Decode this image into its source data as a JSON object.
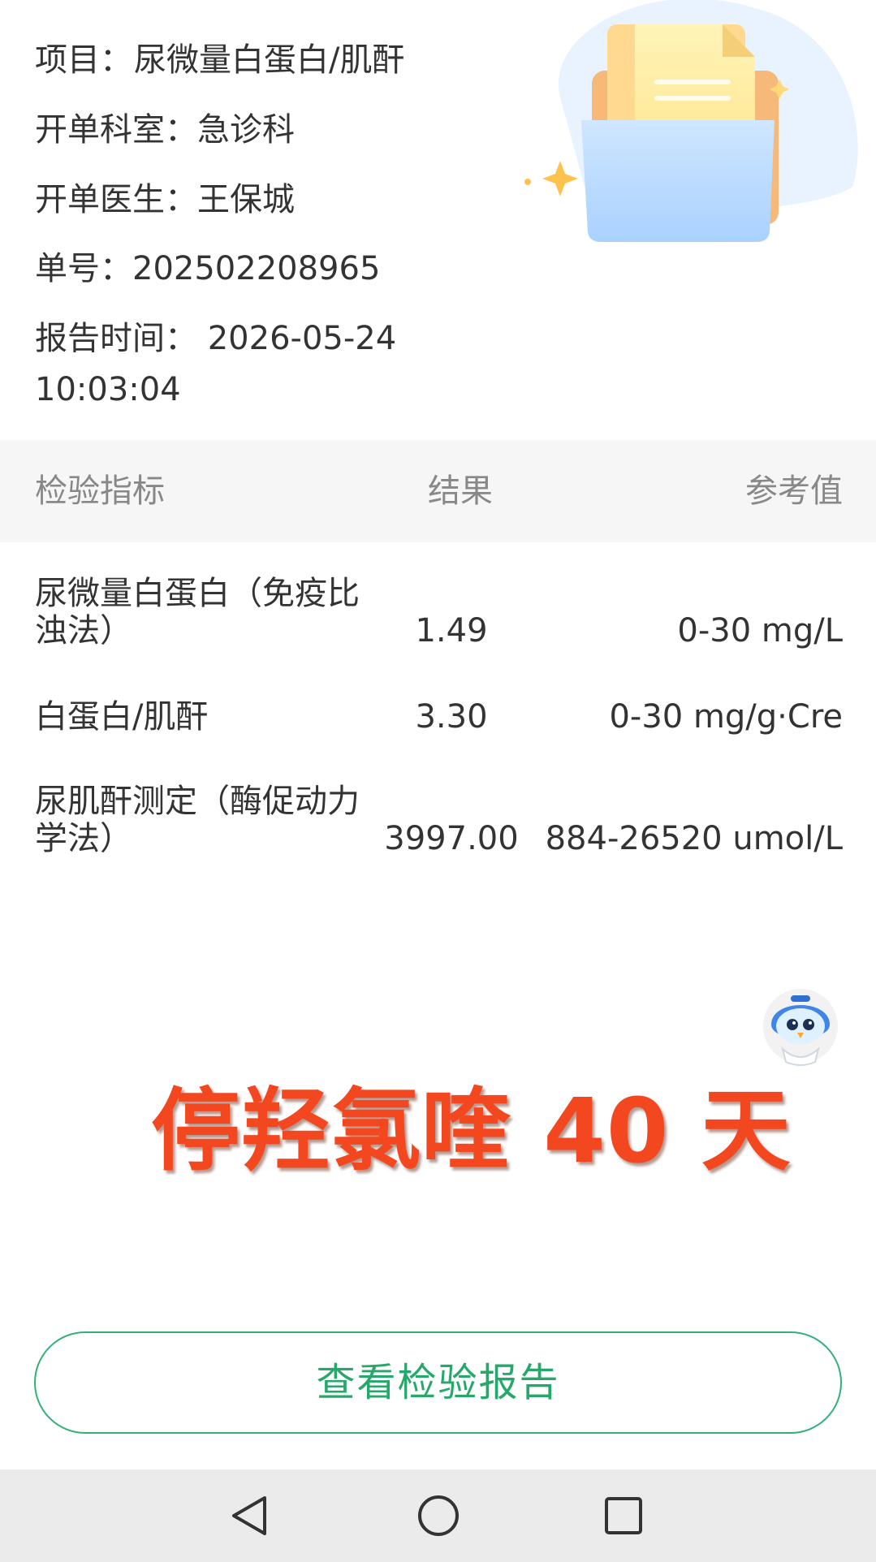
{
  "info": {
    "project_label": "项目：",
    "project_value": "尿微量白蛋白/肌酐",
    "dept_label": "开单科室：",
    "dept_value": "急诊科",
    "doctor_label": "开单医生：",
    "doctor_value": "王保城",
    "order_label": "单号：",
    "order_value": "202502208965",
    "time_label": "报告时间：",
    "time_date": "2026-05-24",
    "time_clock": "10:03:04"
  },
  "table": {
    "headers": {
      "name": "检验指标",
      "result": "结果",
      "reference": "参考值"
    },
    "rows": [
      {
        "name": "尿微量白蛋白（免疫比浊法）",
        "result": "1.49",
        "reference": "0-30 mg/L"
      },
      {
        "name": "白蛋白/肌酐",
        "result": "3.30",
        "reference": "0-30 mg/g·Cre"
      },
      {
        "name": "尿肌酐测定（酶促动力学法）",
        "result": "3997.00",
        "reference": "884-26520 umol/L"
      }
    ]
  },
  "overlay": {
    "caption": "停羟氯喹 40 天"
  },
  "actions": {
    "view_report": "查看检验报告"
  },
  "icons": {
    "illustration": "document-folder-illustration",
    "assistant": "robot-assistant-icon",
    "nav_back": "back-triangle-icon",
    "nav_home": "home-circle-icon",
    "nav_recent": "recent-apps-square-icon"
  },
  "colors": {
    "accent_green": "#27a86b",
    "overlay_red": "#f2471f",
    "header_bg": "#f6f6f6",
    "navbar_bg": "#ebebeb"
  }
}
